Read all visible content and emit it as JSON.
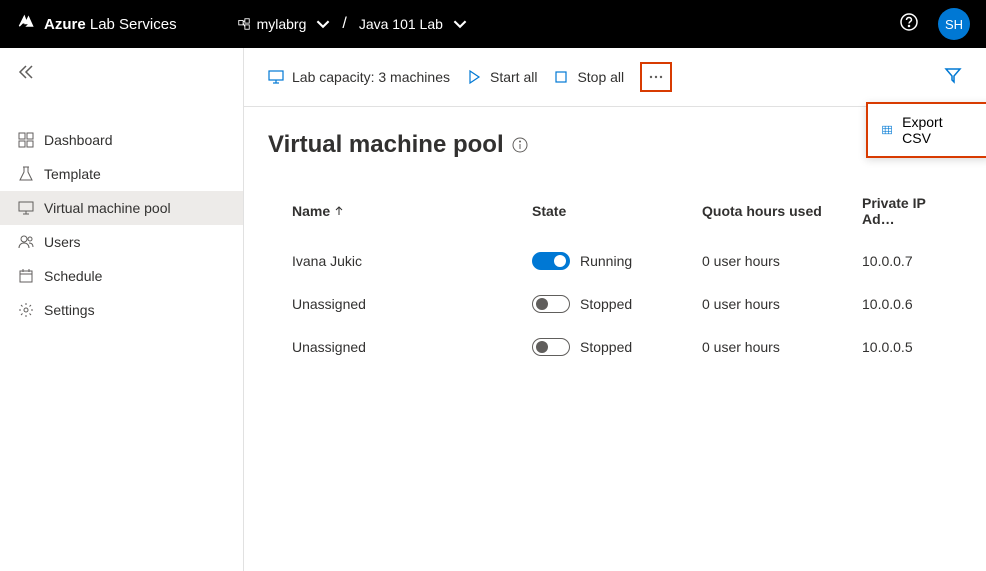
{
  "header": {
    "brand_bold": "Azure",
    "brand_rest": " Lab Services",
    "breadcrumb": {
      "resource_group": "mylabrg",
      "lab": "Java 101 Lab"
    },
    "avatar": "SH"
  },
  "sidebar": {
    "items": [
      {
        "label": "Dashboard"
      },
      {
        "label": "Template"
      },
      {
        "label": "Virtual machine pool"
      },
      {
        "label": "Users"
      },
      {
        "label": "Schedule"
      },
      {
        "label": "Settings"
      }
    ]
  },
  "toolbar": {
    "capacity": "Lab capacity: 3 machines",
    "start_all": "Start all",
    "stop_all": "Stop all",
    "export_csv": "Export CSV"
  },
  "page": {
    "title": "Virtual machine pool"
  },
  "table": {
    "columns": {
      "name": "Name",
      "state": "State",
      "quota": "Quota hours used",
      "ip": "Private IP Ad…"
    },
    "rows": [
      {
        "name": "Ivana Jukic",
        "running": true,
        "state": "Running",
        "quota": "0 user hours",
        "ip": "10.0.0.7"
      },
      {
        "name": "Unassigned",
        "running": false,
        "state": "Stopped",
        "quota": "0 user hours",
        "ip": "10.0.0.6"
      },
      {
        "name": "Unassigned",
        "running": false,
        "state": "Stopped",
        "quota": "0 user hours",
        "ip": "10.0.0.5"
      }
    ]
  }
}
